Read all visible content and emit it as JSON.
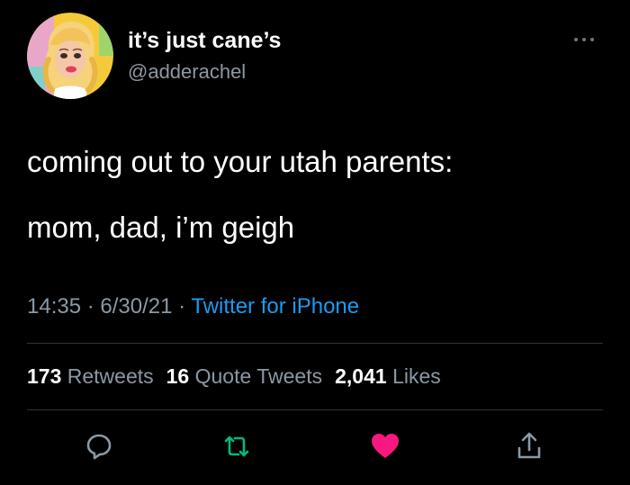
{
  "author": {
    "display_name": "it’s just cane’s",
    "handle": "@adderachel",
    "avatar_icon": "cartoon-blonde-woman-avatar"
  },
  "tweet": {
    "lines": [
      "coming out to your utah parents:",
      "mom, dad, i’m geigh"
    ]
  },
  "meta": {
    "time": "14:35",
    "separator": " · ",
    "date": "6/30/21",
    "source": "Twitter for iPhone"
  },
  "stats": {
    "retweets_count": "173",
    "retweets_label": "Retweets",
    "quote_count": "16",
    "quote_label": "Quote Tweets",
    "likes_count": "2,041",
    "likes_label": "Likes"
  },
  "actions": {
    "reply_icon": "reply-icon",
    "retweet_icon": "retweet-icon",
    "like_icon": "heart-icon",
    "share_icon": "share-icon"
  },
  "colors": {
    "background": "#000000",
    "text": "#ffffff",
    "secondary": "#8b98a5",
    "link": "#1d9bf0",
    "retweet_green": "#00ba7c",
    "like_red": "#f91880",
    "divider": "#2f3336"
  }
}
